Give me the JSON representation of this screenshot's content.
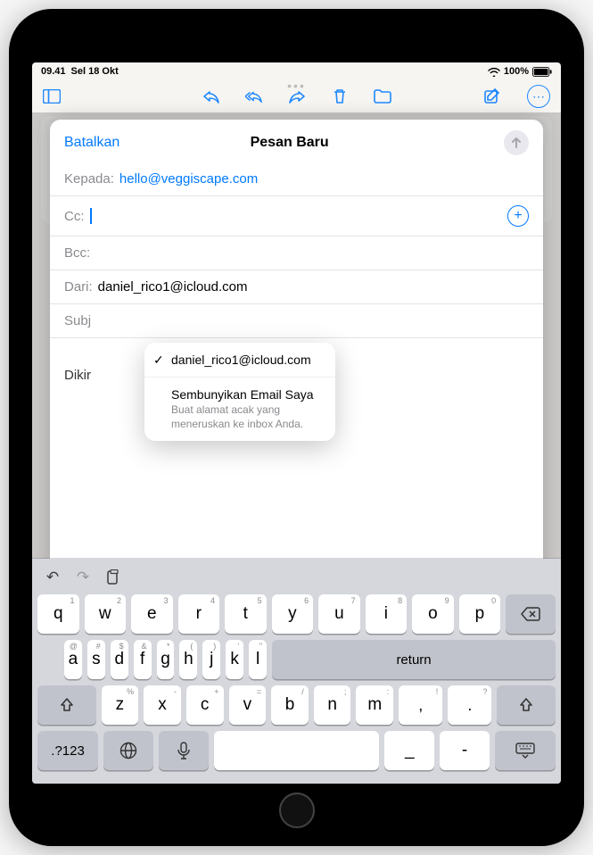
{
  "status": {
    "time": "09.41",
    "date": "Sel 18 Okt",
    "battery": "100%"
  },
  "compose": {
    "cancel": "Batalkan",
    "title": "Pesan Baru",
    "to_label": "Kepada:",
    "to_value": "hello@veggiscape.com",
    "cc_label": "Cc:",
    "bcc_label": "Bcc:",
    "from_label": "Dari:",
    "from_value": "daniel_rico1@icloud.com",
    "subject_label": "Subj",
    "body_sent": "Dikir"
  },
  "from_menu": {
    "selected": "daniel_rico1@icloud.com",
    "hide_title": "Sembunyikan Email Saya",
    "hide_sub": "Buat alamat acak yang meneruskan ke inbox Anda."
  },
  "keyboard": {
    "row1": [
      {
        "k": "q",
        "h": "1"
      },
      {
        "k": "w",
        "h": "2"
      },
      {
        "k": "e",
        "h": "3"
      },
      {
        "k": "r",
        "h": "4"
      },
      {
        "k": "t",
        "h": "5"
      },
      {
        "k": "y",
        "h": "6"
      },
      {
        "k": "u",
        "h": "7"
      },
      {
        "k": "i",
        "h": "8"
      },
      {
        "k": "o",
        "h": "9"
      },
      {
        "k": "p",
        "h": "0"
      }
    ],
    "row2": [
      {
        "k": "a",
        "h": "@"
      },
      {
        "k": "s",
        "h": "#"
      },
      {
        "k": "d",
        "h": "$"
      },
      {
        "k": "f",
        "h": "&"
      },
      {
        "k": "g",
        "h": "*"
      },
      {
        "k": "h",
        "h": "("
      },
      {
        "k": "j",
        "h": ")"
      },
      {
        "k": "k",
        "h": "'"
      },
      {
        "k": "l",
        "h": "\""
      }
    ],
    "row3": [
      {
        "k": "z",
        "h": "%"
      },
      {
        "k": "x",
        "h": "-"
      },
      {
        "k": "c",
        "h": "+"
      },
      {
        "k": "v",
        "h": "="
      },
      {
        "k": "b",
        "h": "/"
      },
      {
        "k": "n",
        "h": ";"
      },
      {
        "k": "m",
        "h": ":"
      }
    ],
    "mode": ".?123",
    "return": "return",
    "punct1": "_",
    "punct2": "-"
  }
}
